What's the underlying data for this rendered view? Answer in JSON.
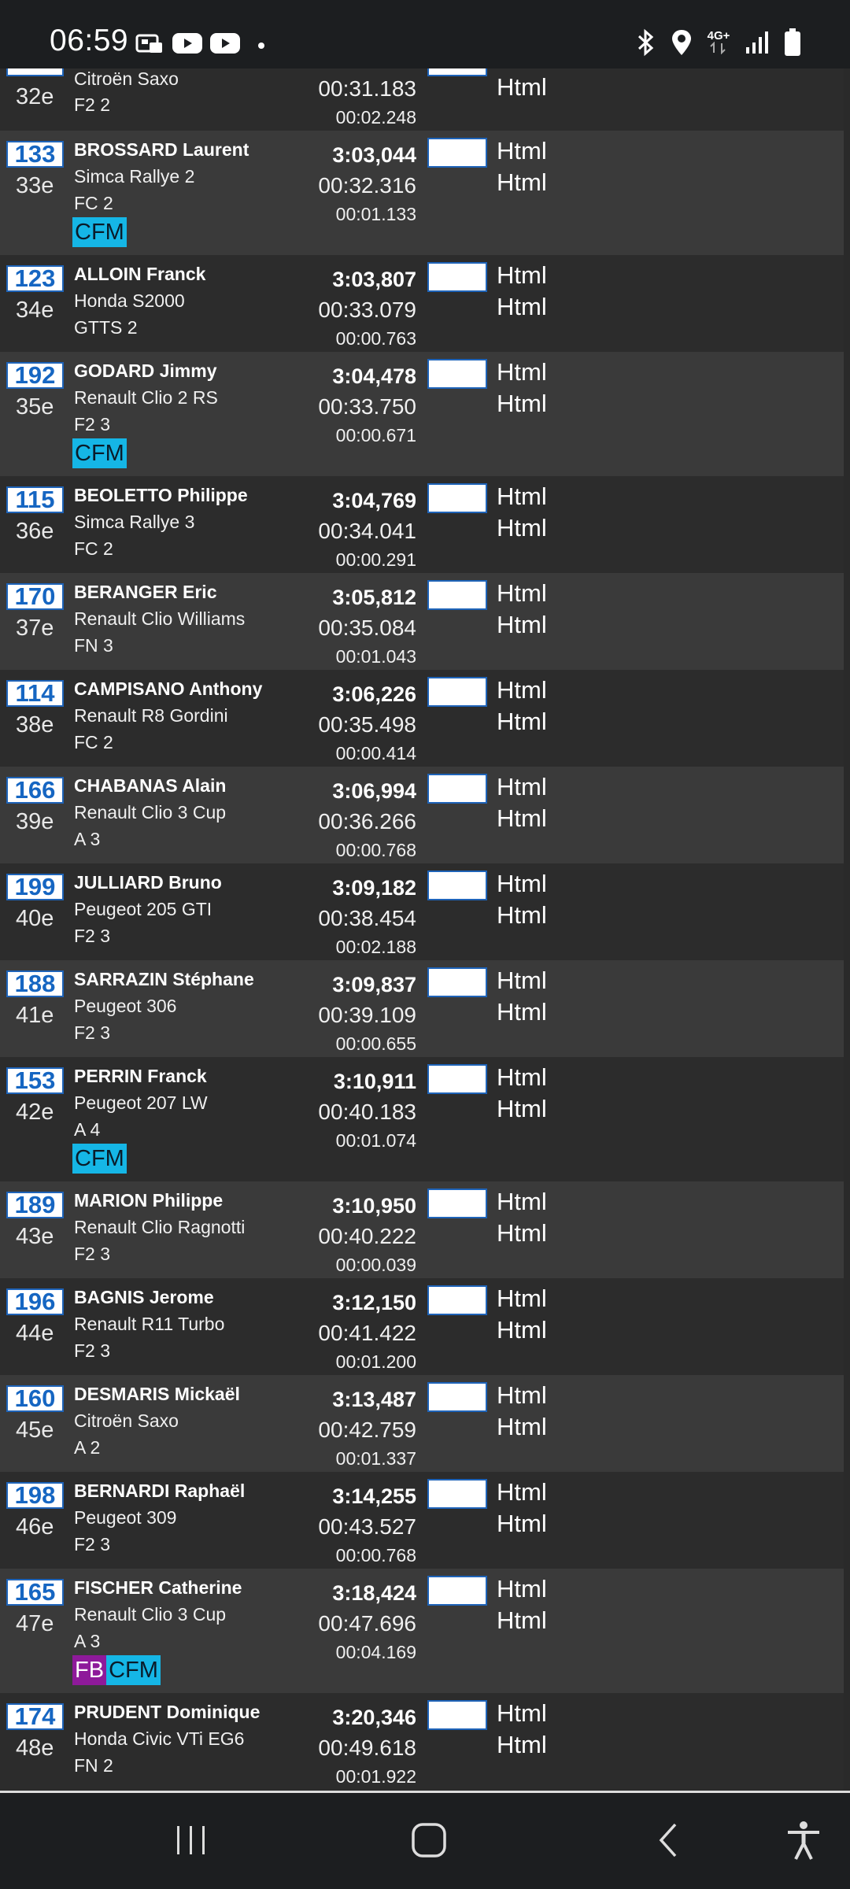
{
  "status": {
    "time": "06:59",
    "left_icons": [
      "screen-record-icon",
      "youtube-icon",
      "youtube-icon",
      "notification-dot"
    ],
    "right_icons": [
      "bluetooth-icon",
      "location-icon",
      "network-4g-icon",
      "signal-icon",
      "battery-icon"
    ],
    "network_label": "4G+"
  },
  "partial_row": {
    "rank": "32e",
    "car": "Citroën Saxo",
    "class": "F2 2",
    "gap1": "00:31.183",
    "gap2": "00:02.248",
    "html1": "Html"
  },
  "entries": [
    {
      "number": "133",
      "rank": "33e",
      "name": "BROSSARD Laurent",
      "car": "Simca Rallye 2",
      "class": "FC 2",
      "total": "3:03,044",
      "gap1": "00:32.316",
      "gap2": "00:01.133",
      "html1": "Html",
      "html2": "Html",
      "badges": [
        "CFM"
      ]
    },
    {
      "number": "123",
      "rank": "34e",
      "name": "ALLOIN Franck",
      "car": "Honda S2000",
      "class": "GTTS 2",
      "total": "3:03,807",
      "gap1": "00:33.079",
      "gap2": "00:00.763",
      "html1": "Html",
      "html2": "Html",
      "badges": []
    },
    {
      "number": "192",
      "rank": "35e",
      "name": "GODARD Jimmy",
      "car": "Renault Clio 2 RS",
      "class": "F2 3",
      "total": "3:04,478",
      "gap1": "00:33.750",
      "gap2": "00:00.671",
      "html1": "Html",
      "html2": "Html",
      "badges": [
        "CFM"
      ]
    },
    {
      "number": "115",
      "rank": "36e",
      "name": "BEOLETTO Philippe",
      "car": "Simca Rallye 3",
      "class": "FC 2",
      "total": "3:04,769",
      "gap1": "00:34.041",
      "gap2": "00:00.291",
      "html1": "Html",
      "html2": "Html",
      "badges": []
    },
    {
      "number": "170",
      "rank": "37e",
      "name": "BERANGER Eric",
      "car": "Renault Clio Williams",
      "class": "FN 3",
      "total": "3:05,812",
      "gap1": "00:35.084",
      "gap2": "00:01.043",
      "html1": "Html",
      "html2": "Html",
      "badges": []
    },
    {
      "number": "114",
      "rank": "38e",
      "name": "CAMPISANO Anthony",
      "car": "Renault R8 Gordini",
      "class": "FC 2",
      "total": "3:06,226",
      "gap1": "00:35.498",
      "gap2": "00:00.414",
      "html1": "Html",
      "html2": "Html",
      "badges": []
    },
    {
      "number": "166",
      "rank": "39e",
      "name": "CHABANAS Alain",
      "car": "Renault Clio 3 Cup",
      "class": "A 3",
      "total": "3:06,994",
      "gap1": "00:36.266",
      "gap2": "00:00.768",
      "html1": "Html",
      "html2": "Html",
      "badges": []
    },
    {
      "number": "199",
      "rank": "40e",
      "name": "JULLIARD Bruno",
      "car": "Peugeot 205 GTI",
      "class": "F2 3",
      "total": "3:09,182",
      "gap1": "00:38.454",
      "gap2": "00:02.188",
      "html1": "Html",
      "html2": "Html",
      "badges": []
    },
    {
      "number": "188",
      "rank": "41e",
      "name": "SARRAZIN Stéphane",
      "car": "Peugeot 306",
      "class": "F2 3",
      "total": "3:09,837",
      "gap1": "00:39.109",
      "gap2": "00:00.655",
      "html1": "Html",
      "html2": "Html",
      "badges": []
    },
    {
      "number": "153",
      "rank": "42e",
      "name": "PERRIN Franck",
      "car": "Peugeot 207 LW",
      "class": "A 4",
      "total": "3:10,911",
      "gap1": "00:40.183",
      "gap2": "00:01.074",
      "html1": "Html",
      "html2": "Html",
      "badges": [
        "CFM"
      ]
    },
    {
      "number": "189",
      "rank": "43e",
      "name": "MARION Philippe",
      "car": "Renault Clio Ragnotti",
      "class": "F2 3",
      "total": "3:10,950",
      "gap1": "00:40.222",
      "gap2": "00:00.039",
      "html1": "Html",
      "html2": "Html",
      "badges": []
    },
    {
      "number": "196",
      "rank": "44e",
      "name": "BAGNIS Jerome",
      "car": "Renault R11 Turbo",
      "class": "F2 3",
      "total": "3:12,150",
      "gap1": "00:41.422",
      "gap2": "00:01.200",
      "html1": "Html",
      "html2": "Html",
      "badges": []
    },
    {
      "number": "160",
      "rank": "45e",
      "name": "DESMARIS Mickaël",
      "car": "Citroën Saxo",
      "class": "A 2",
      "total": "3:13,487",
      "gap1": "00:42.759",
      "gap2": "00:01.337",
      "html1": "Html",
      "html2": "Html",
      "badges": []
    },
    {
      "number": "198",
      "rank": "46e",
      "name": "BERNARDI Raphaël",
      "car": "Peugeot 309",
      "class": "F2 3",
      "total": "3:14,255",
      "gap1": "00:43.527",
      "gap2": "00:00.768",
      "html1": "Html",
      "html2": "Html",
      "badges": []
    },
    {
      "number": "165",
      "rank": "47e",
      "name": "FISCHER Catherine",
      "car": "Renault Clio 3 Cup",
      "class": "A 3",
      "total": "3:18,424",
      "gap1": "00:47.696",
      "gap2": "00:04.169",
      "html1": "Html",
      "html2": "Html",
      "badges": [
        "FB",
        "CFM"
      ]
    },
    {
      "number": "174",
      "rank": "48e",
      "name": "PRUDENT Dominique",
      "car": "Honda Civic VTi EG6",
      "class": "FN 2",
      "total": "3:20,346",
      "gap1": "00:49.618",
      "gap2": "00:01.922",
      "html1": "Html",
      "html2": "Html",
      "badges": []
    }
  ],
  "navbar": {
    "buttons": [
      "recent-apps-icon",
      "home-icon",
      "back-icon",
      "accessibility-icon"
    ]
  },
  "colors": {
    "row_light": "#3a3a3a",
    "row_dark": "#2c2c2c",
    "number_blue": "#1666c2",
    "badge_cfm": "#15b6e6",
    "badge_fb": "#8e1a9a",
    "bars": "#1c1e20"
  }
}
